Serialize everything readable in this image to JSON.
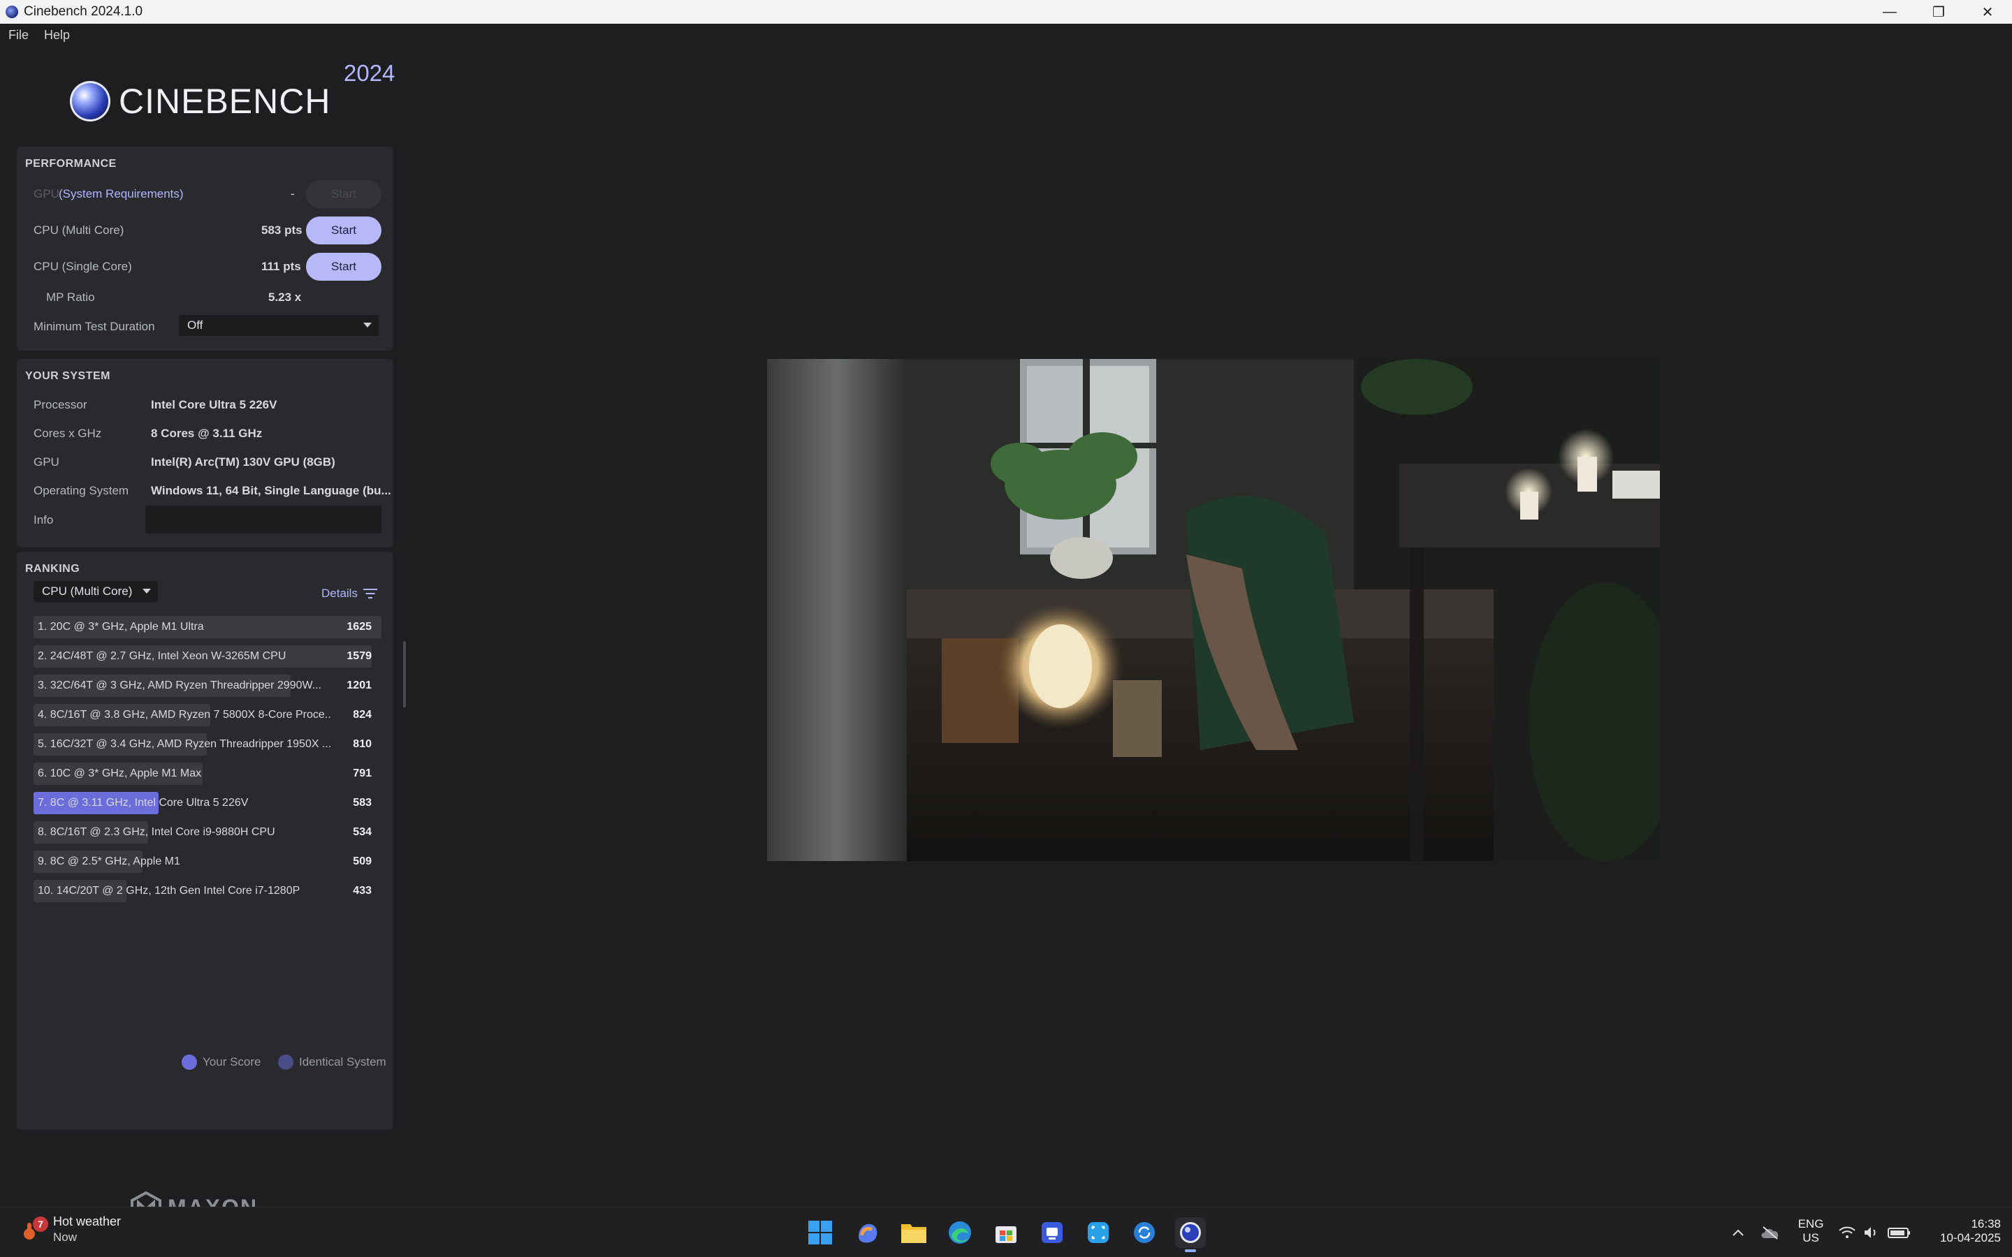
{
  "window": {
    "title": "Cinebench 2024.1.0",
    "controls": {
      "minimize": "—",
      "restore": "❐",
      "close": "✕"
    }
  },
  "menu": {
    "items": [
      "File",
      "Help"
    ]
  },
  "logo": {
    "wordmark": "CINEBENCH",
    "year": "2024"
  },
  "performance": {
    "title": "PERFORMANCE",
    "gpu": {
      "label": "GPU",
      "link": "(System Requirements)",
      "value": "-",
      "button": "Start"
    },
    "multi": {
      "label": "CPU (Multi Core)",
      "value": "583 pts",
      "button": "Start"
    },
    "single": {
      "label": "CPU (Single Core)",
      "value": "111 pts",
      "button": "Start"
    },
    "mp_ratio": {
      "label": "MP Ratio",
      "value": "5.23 x"
    },
    "min_duration": {
      "label": "Minimum Test Duration",
      "value": "Off"
    }
  },
  "system": {
    "title": "YOUR SYSTEM",
    "rows": [
      {
        "label": "Processor",
        "value": "Intel Core Ultra 5 226V"
      },
      {
        "label": "Cores x GHz",
        "value": "8 Cores @ 3.11 GHz"
      },
      {
        "label": "GPU",
        "value": "Intel(R) Arc(TM) 130V GPU (8GB)"
      },
      {
        "label": "Operating System",
        "value": "Windows 11, 64 Bit, Single Language (bu..."
      },
      {
        "label": "Info",
        "value": ""
      }
    ]
  },
  "ranking": {
    "title": "RANKING",
    "selector": "CPU (Multi Core)",
    "details": "Details",
    "max_score": 1625,
    "rows": [
      {
        "text": "1. 20C @ 3* GHz, Apple M1 Ultra",
        "score": 1625,
        "mine": false
      },
      {
        "text": "2. 24C/48T @ 2.7 GHz, Intel Xeon W-3265M CPU",
        "score": 1579,
        "mine": false
      },
      {
        "text": "3. 32C/64T @ 3 GHz, AMD Ryzen Threadripper 2990W...",
        "score": 1201,
        "mine": false
      },
      {
        "text": "4. 8C/16T @ 3.8 GHz, AMD Ryzen 7 5800X 8-Core Proce...",
        "score": 824,
        "mine": false
      },
      {
        "text": "5. 16C/32T @ 3.4 GHz, AMD Ryzen Threadripper 1950X ...",
        "score": 810,
        "mine": false
      },
      {
        "text": "6. 10C @ 3* GHz, Apple M1 Max",
        "score": 791,
        "mine": false
      },
      {
        "text": "7. 8C @ 3.11 GHz, Intel Core Ultra 5 226V",
        "score": 583,
        "mine": true
      },
      {
        "text": "8. 8C/16T @ 2.3 GHz, Intel Core i9-9880H CPU",
        "score": 534,
        "mine": false
      },
      {
        "text": "9. 8C @ 2.5* GHz, Apple M1",
        "score": 509,
        "mine": false
      },
      {
        "text": "10. 14C/20T @ 2 GHz, 12th Gen Intel Core i7-1280P",
        "score": 433,
        "mine": false
      }
    ],
    "legend": {
      "your_score": "Your Score",
      "identical": "Identical System",
      "your_color": "#6b6ddb",
      "identical_color": "#4a4c88"
    }
  },
  "footer": {
    "brand": "MAXON"
  },
  "taskbar": {
    "weather_title": "Hot weather",
    "weather_sub": "Now",
    "weather_badge": "7",
    "apps": [
      "start-icon",
      "copilot-icon",
      "file-explorer-icon",
      "edge-icon",
      "store-icon",
      "teams-icon",
      "snipping-tool-icon",
      "sync-icon",
      "cinebench-icon"
    ],
    "lang": "ENG",
    "region": "US",
    "time": "16:38",
    "date": "10-04-2025"
  }
}
